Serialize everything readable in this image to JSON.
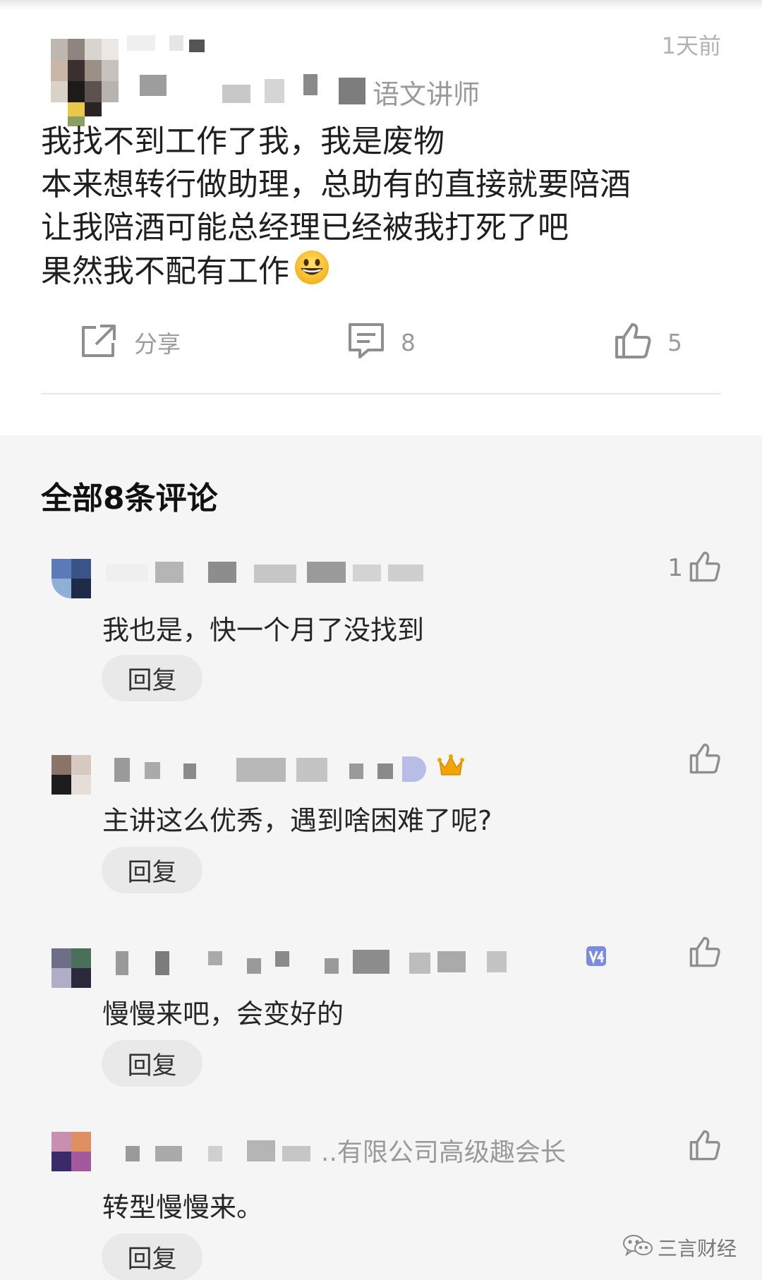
{
  "post": {
    "time": "1天前",
    "author_title_suffix": "语文讲师",
    "content_lines": [
      "我找不到工作了我，我是废物",
      "本来想转行做助理，总助有的直接就要陪酒",
      "让我陪酒可能总经理已经被我打死了吧",
      "果然我不配有工作"
    ],
    "emoji_icon": "grinning-face-emoji",
    "actions": {
      "share_label": "分享",
      "comment_count": "8",
      "like_count": "5"
    }
  },
  "comments_section": {
    "heading": "全部8条评论",
    "comments": [
      {
        "text": "我也是，快一个月了没找到",
        "like_count": "1",
        "reply_label": "回复",
        "badge": ""
      },
      {
        "text": "主讲这么优秀，遇到啥困难了呢?",
        "like_count": "",
        "reply_label": "回复",
        "badge": "crown-icon"
      },
      {
        "text": "慢慢来吧，会变好的",
        "like_count": "",
        "reply_label": "回复",
        "badge": "level-4-badge-icon"
      },
      {
        "text": "转型慢慢来。",
        "like_count": "",
        "reply_label": "回复",
        "author_suffix": "..有限公司高级趣会长",
        "badge": ""
      }
    ]
  },
  "watermark": {
    "text": "三言财经",
    "icon": "wechat-icon"
  },
  "colors": {
    "page_bg": "#f5f5f5",
    "card_bg": "#ffffff",
    "muted_text": "#9c9c9c",
    "reply_bg": "#e9e9e9",
    "badge_blue": "#7b8cde",
    "crown_gold": "#f0a500"
  }
}
